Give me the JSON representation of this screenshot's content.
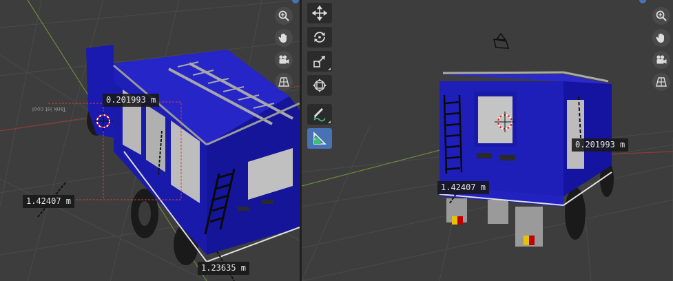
{
  "left_viewport": {
    "measurements": [
      "0.201993 m",
      "1.42407 m",
      "1.23635 m"
    ],
    "ground_text": "Tank ist cool"
  },
  "right_viewport": {
    "measurements": [
      "0.201993 m",
      "1.42407 m"
    ]
  },
  "navigation_gizmo": [
    "zoom-icon",
    "hand-pan-icon",
    "camera-view-icon",
    "perspective-grid-icon"
  ],
  "toolbar": [
    "move-tool-icon",
    "rotate-tool-icon",
    "scale-tool-icon",
    "transform-tool-icon",
    "annotate-tool-icon",
    "measure-tool-icon"
  ],
  "active_tool": "measure-tool-icon",
  "colors": {
    "accent": "#4772b3",
    "truck_body": "#1f1fb4",
    "viewport_bg": "#3d3d3d"
  }
}
